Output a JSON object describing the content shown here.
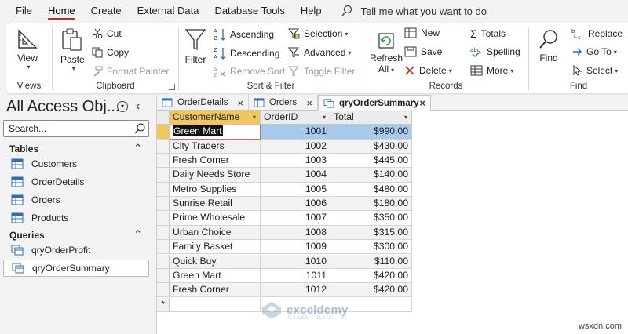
{
  "menu": {
    "items": [
      "File",
      "Home",
      "Create",
      "External Data",
      "Database Tools",
      "Help"
    ],
    "active": "Home",
    "tell_me": "Tell me what you want to do"
  },
  "ribbon": {
    "views": {
      "view_label": "View",
      "group_label": "Views"
    },
    "clipboard": {
      "paste_label": "Paste",
      "cut_label": "Cut",
      "copy_label": "Copy",
      "format_painter_label": "Format Painter",
      "group_label": "Clipboard"
    },
    "sort_filter": {
      "filter_label": "Filter",
      "ascending_label": "Ascending",
      "descending_label": "Descending",
      "remove_sort_label": "Remove Sort",
      "selection_label": "Selection",
      "advanced_label": "Advanced",
      "toggle_filter_label": "Toggle Filter",
      "group_label": "Sort & Filter"
    },
    "records": {
      "refresh_label": "Refresh",
      "refresh_sub": "All",
      "new_label": "New",
      "save_label": "Save",
      "delete_label": "Delete",
      "totals_label": "Totals",
      "spelling_label": "Spelling",
      "more_label": "More",
      "group_label": "Records"
    },
    "find": {
      "find_label": "Find",
      "replace_label": "Replace",
      "goto_label": "Go To",
      "select_label": "Select",
      "group_label": "Find"
    }
  },
  "nav": {
    "title": "All Access Obj...",
    "search_placeholder": "Search...",
    "tables_header": "Tables",
    "tables": [
      "Customers",
      "OrderDetails",
      "Orders",
      "Products"
    ],
    "queries_header": "Queries",
    "queries": [
      "qryOrderProfit",
      "qryOrderSummary"
    ],
    "selected_query": "qryOrderSummary"
  },
  "tabs": [
    {
      "label": "OrderDetails",
      "active": false
    },
    {
      "label": "Orders",
      "active": false
    },
    {
      "label": "qryOrderSummary",
      "active": true
    }
  ],
  "datasheet": {
    "columns": [
      "CustomerName",
      "OrderID",
      "Total"
    ],
    "rows": [
      [
        "Green Mart",
        "1001",
        "$990.00"
      ],
      [
        "City Traders",
        "1002",
        "$430.00"
      ],
      [
        "Fresh Corner",
        "1003",
        "$445.00"
      ],
      [
        "Daily Needs Store",
        "1004",
        "$140.00"
      ],
      [
        "Metro Supplies",
        "1005",
        "$480.00"
      ],
      [
        "Sunrise Retail",
        "1006",
        "$180.00"
      ],
      [
        "Prime Wholesale",
        "1007",
        "$350.00"
      ],
      [
        "Urban Choice",
        "1008",
        "$315.00"
      ],
      [
        "Family Basket",
        "1009",
        "$300.00"
      ],
      [
        "Quick Buy",
        "1010",
        "$110.00"
      ],
      [
        "Green Mart",
        "1011",
        "$420.00"
      ],
      [
        "Fresh Corner",
        "1012",
        "$420.00"
      ]
    ],
    "new_row_marker": "*"
  },
  "watermark": {
    "brand": "exceldemy",
    "tagline": "EXCEL · DATA · BI"
  },
  "corner_tag": "wsxdn.com",
  "colors": {
    "accent": "#a4373a",
    "selected_header": "#f0c75e",
    "row_highlight": "#a6c9ec"
  }
}
